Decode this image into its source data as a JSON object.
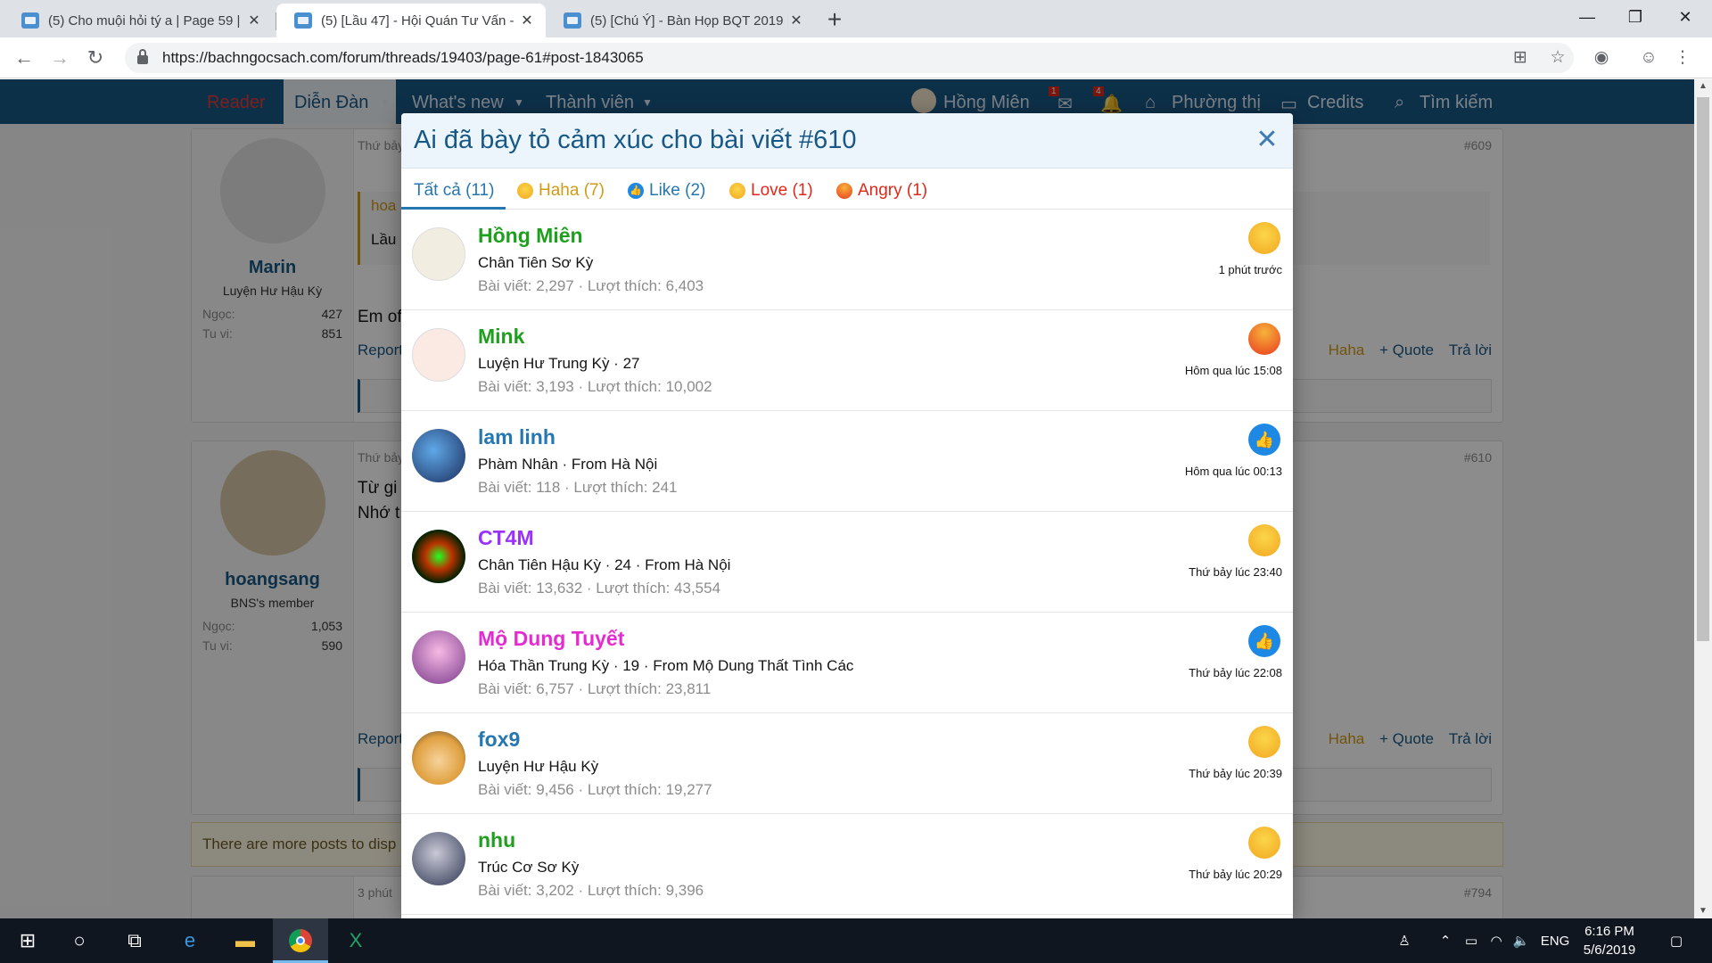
{
  "browser": {
    "tabs": [
      {
        "title": "(5) Cho muội hỏi tý a | Page 59 | ",
        "active": false
      },
      {
        "title": "(5) [Lầu 47] - Hội Quán Tư Vấn - ",
        "active": true
      },
      {
        "title": "(5) [Chú Ý] - Bàn Họp BQT 2019 |",
        "active": false
      }
    ],
    "url": "https://bachngocsach.com/forum/threads/19403/page-61#post-1843065"
  },
  "site_nav": {
    "reader": "Reader",
    "forums": "Diễn Đàn",
    "whats_new": "What's new",
    "members": "Thành viên",
    "user": "Hồng Miên",
    "inbox_count": "1",
    "alerts_count": "4",
    "phuong_thi": "Phường thị",
    "credits": "Credits",
    "search": "Tìm kiếm"
  },
  "posts": [
    {
      "user": "Marin",
      "title": "Luyện Hư Hậu Kỳ",
      "stats": [
        {
          "k": "Ngọc:",
          "v": "427"
        },
        {
          "k": "Tu vi:",
          "v": "851"
        }
      ],
      "meta": "Thứ bảy",
      "num": "#609",
      "quote_author": "hoa",
      "quote_text": "Lầu",
      "body": "Em of",
      "report": "Report",
      "haha": "Haha",
      "quote": "+ Quote",
      "reply": "Trả lời"
    },
    {
      "user": "hoangsang",
      "title": "BNS's member",
      "stats": [
        {
          "k": "Ngọc:",
          "v": "1,053"
        },
        {
          "k": "Tu vi:",
          "v": "590"
        }
      ],
      "meta": "Thứ bảy",
      "num": "#610",
      "body": "Từ gi",
      "body2": "Nhớ t",
      "report": "Report",
      "haha": "Haha",
      "quote": "+ Quote",
      "reply": "Trả lời"
    }
  ],
  "more_posts": "There are more posts to disp",
  "third_post": {
    "meta": "3 phút",
    "num": "#794"
  },
  "modal": {
    "title": "Ai đã bày tỏ cảm xúc cho bài viết #610",
    "tabs": [
      {
        "label": "Tất cả (11)",
        "icon": "none"
      },
      {
        "label": "Haha (7)",
        "icon": "haha-icon"
      },
      {
        "label": "Like (2)",
        "icon": "like-icon"
      },
      {
        "label": "Love (1)",
        "icon": "love-icon"
      },
      {
        "label": "Angry (1)",
        "icon": "angry-icon"
      }
    ],
    "reactions": [
      {
        "name": "Hồng Miên",
        "line1": "Chân Tiên Sơ Kỳ",
        "line2": "Bài viết: 2,297 · Lượt thích: 6,403",
        "reaction": "haha",
        "time": "1 phút trước",
        "color": "#1ea01e"
      },
      {
        "name": "Mink",
        "line1": "Luyện Hư Trung Kỳ · 27",
        "line2": "Bài viết: 3,193 · Lượt thích: 10,002",
        "reaction": "angry",
        "time": "Hôm qua lúc 15:08",
        "color": "#1ea01e"
      },
      {
        "name": "lam linh",
        "line1": "Phàm Nhân · From Hà Nội",
        "line2": "Bài viết: 118 · Lượt thích: 241",
        "reaction": "like",
        "time": "Hôm qua lúc 00:13",
        "color": "#2577b1"
      },
      {
        "name": "CT4M",
        "line1": "Chân Tiên Hậu Kỳ · 24 · From Hà Nội",
        "line2": "Bài viết: 13,632 · Lượt thích: 43,554",
        "reaction": "haha",
        "time": "Thứ bảy lúc 23:40",
        "color": "#9b30ff"
      },
      {
        "name": "Mộ Dung Tuyết",
        "line1": "Hóa Thần Trung Kỳ · 19 · From Mộ Dung Thất Tình Các",
        "line2": "Bài viết: 6,757 · Lượt thích: 23,811",
        "reaction": "like",
        "time": "Thứ bảy lúc 22:08",
        "color": "#e52ad2"
      },
      {
        "name": "fox9",
        "line1": "Luyện Hư Hậu Kỳ",
        "line2": "Bài viết: 9,456 · Lượt thích: 19,277",
        "reaction": "haha",
        "time": "Thứ bảy lúc 20:39",
        "color": "#2577b1"
      },
      {
        "name": "nhu",
        "line1": "Trúc Cơ Sơ Kỳ",
        "line2": "Bài viết: 3,202 · Lượt thích: 9,396",
        "reaction": "haha",
        "time": "Thứ bảy lúc 20:29",
        "color": "#1ea01e"
      }
    ]
  },
  "taskbar": {
    "lang": "ENG",
    "time": "6:16 PM",
    "date": "5/6/2019"
  }
}
